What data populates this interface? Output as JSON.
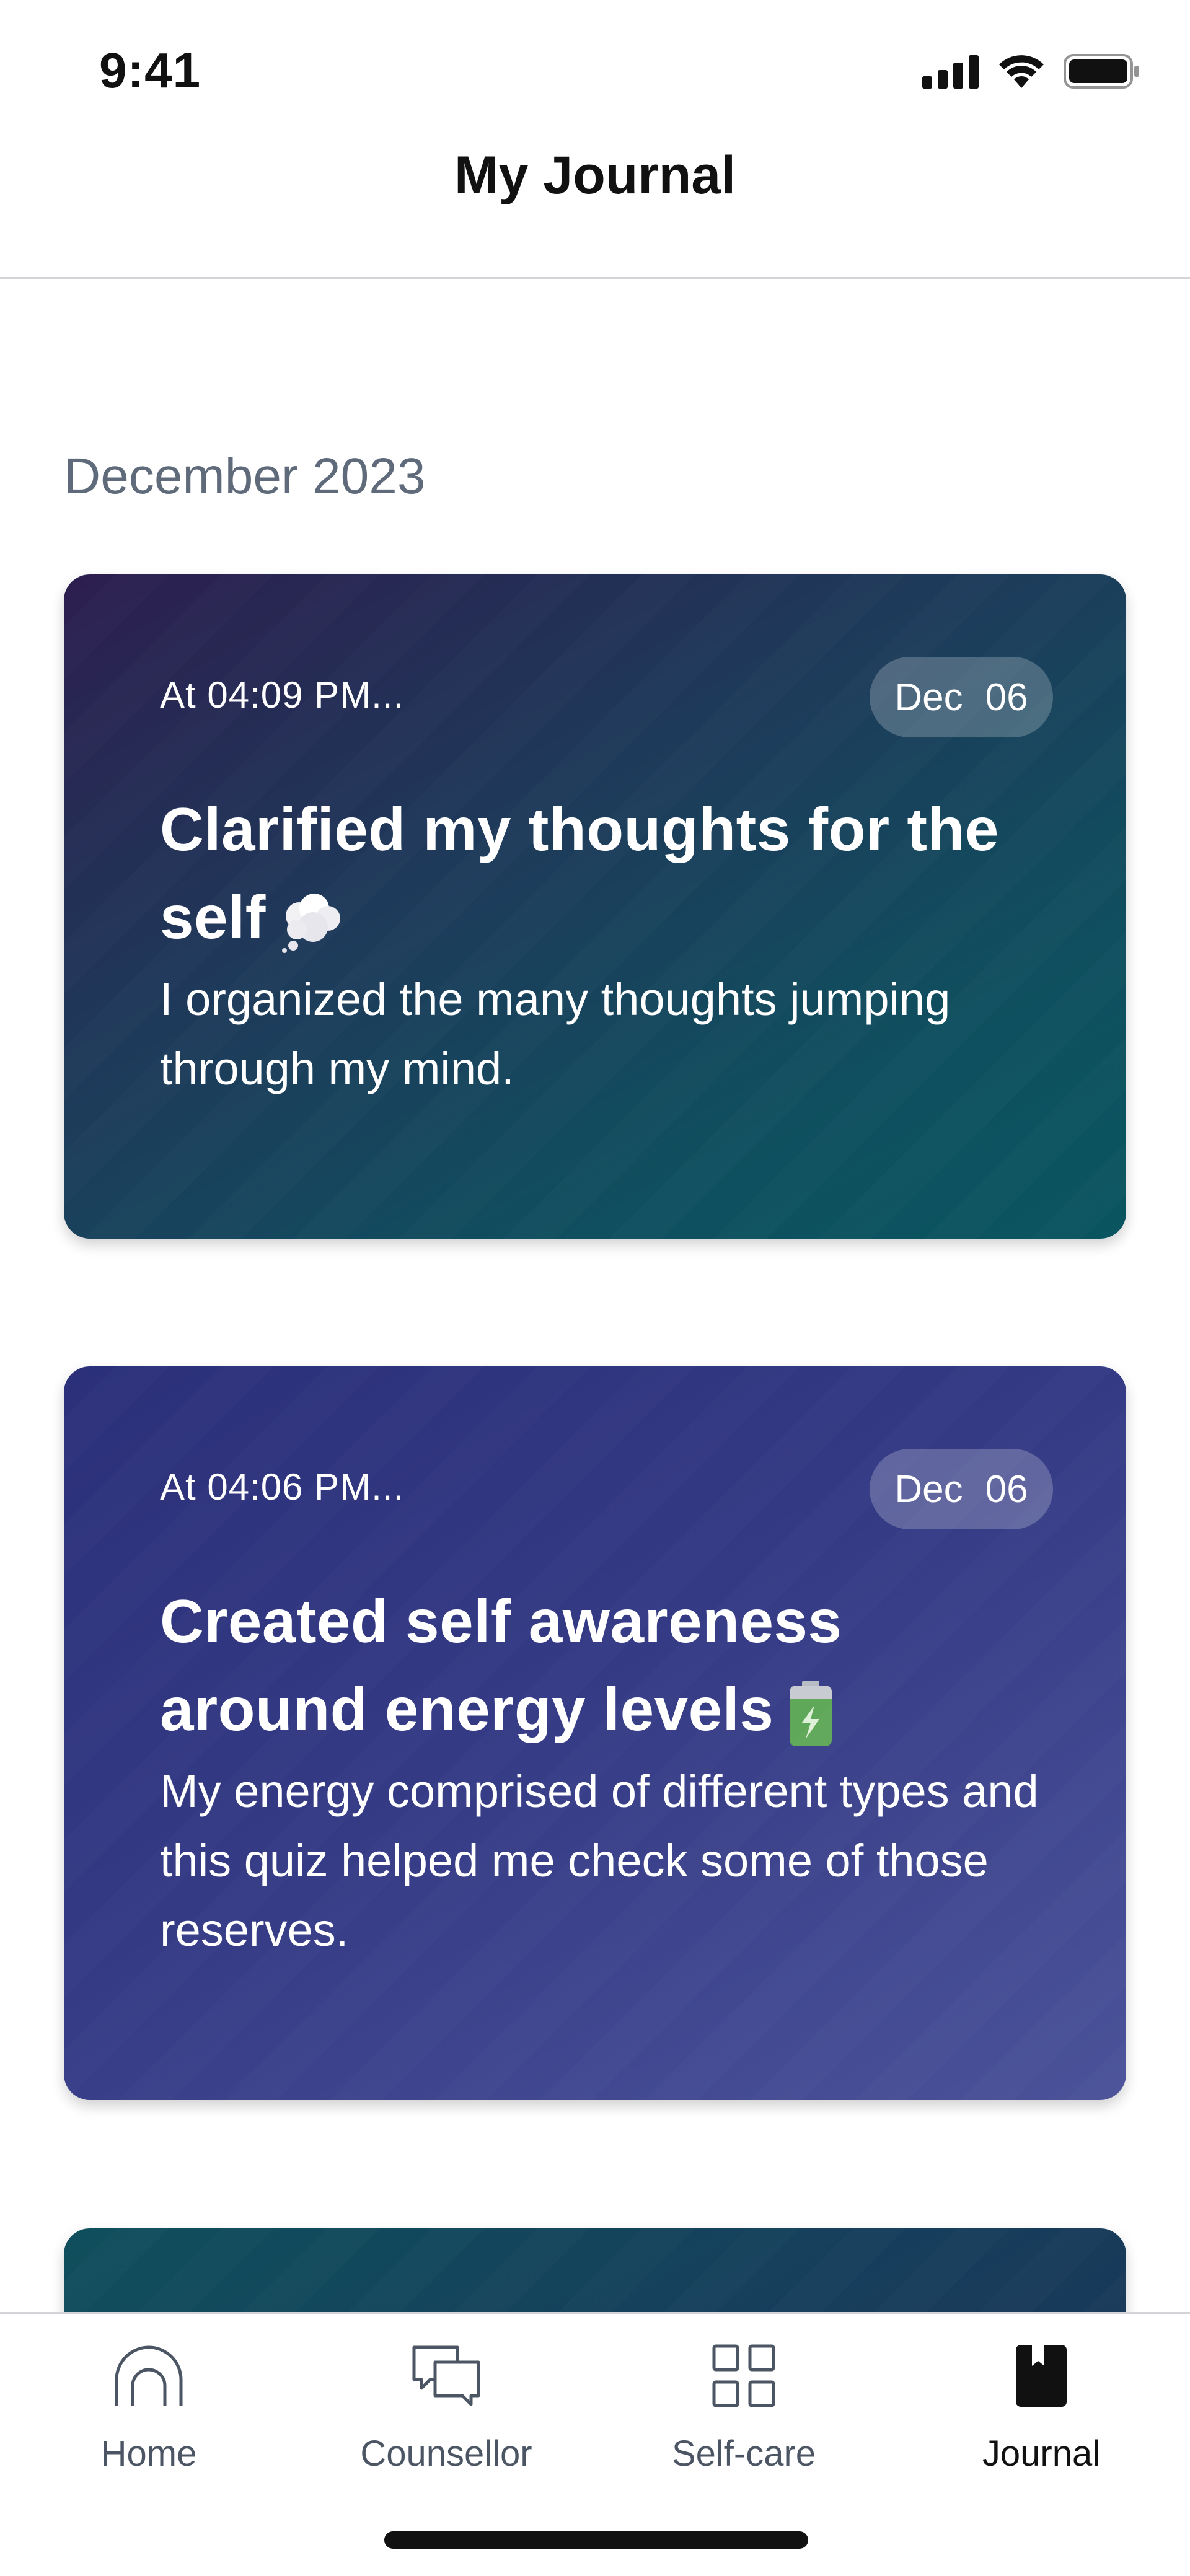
{
  "status_bar": {
    "time": "9:41"
  },
  "header": {
    "title": "My Journal"
  },
  "section": {
    "month": "December 2023"
  },
  "entries": [
    {
      "time": "At 04:09 PM...",
      "date_month": "Dec",
      "date_day": "06",
      "title": "Clarified my thoughts for the self",
      "emoji_icon": "thought-bubble-icon",
      "body": "I organized the many thoughts jumping through my mind."
    },
    {
      "time": "At 04:06 PM...",
      "date_month": "Dec",
      "date_day": "06",
      "title": "Created self awareness around energy levels",
      "emoji_icon": "battery-icon",
      "body": "My energy comprised of different types and this quiz helped me check some of those reserves."
    }
  ],
  "tab_bar": {
    "items": [
      {
        "label": "Home",
        "icon": "home-icon",
        "active": false
      },
      {
        "label": "Counsellor",
        "icon": "chat-bubbles-icon",
        "active": false
      },
      {
        "label": "Self-care",
        "icon": "grid-icon",
        "active": false
      },
      {
        "label": "Journal",
        "icon": "journal-icon",
        "active": true
      }
    ]
  },
  "colors": {
    "accent_text": "#111111",
    "muted_text": "#5f6b7a",
    "card1_start": "#2c1e4f",
    "card1_end": "#0a5560",
    "card2_start": "#2b3079",
    "card2_end": "#4b5298"
  }
}
